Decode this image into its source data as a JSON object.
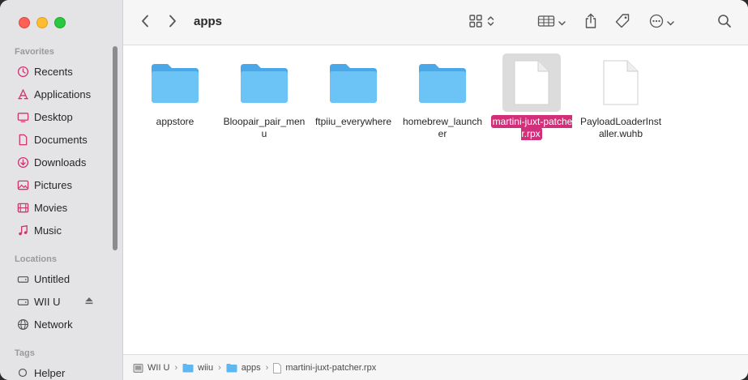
{
  "window": {
    "title": "apps"
  },
  "sidebar": {
    "favorites_header": "Favorites",
    "favorites": [
      {
        "label": "Recents",
        "icon": "clock-icon"
      },
      {
        "label": "Applications",
        "icon": "applications-icon"
      },
      {
        "label": "Desktop",
        "icon": "desktop-icon"
      },
      {
        "label": "Documents",
        "icon": "document-icon"
      },
      {
        "label": "Downloads",
        "icon": "download-icon"
      },
      {
        "label": "Pictures",
        "icon": "pictures-icon"
      },
      {
        "label": "Movies",
        "icon": "movies-icon"
      },
      {
        "label": "Music",
        "icon": "music-icon"
      }
    ],
    "locations_header": "Locations",
    "locations": [
      {
        "label": "Untitled",
        "icon": "drive-icon"
      },
      {
        "label": "WII U",
        "icon": "drive-icon"
      },
      {
        "label": "Network",
        "icon": "network-icon"
      }
    ],
    "tags_header": "Tags",
    "tags": [
      {
        "label": "Helper",
        "icon": "tag-circle-icon"
      }
    ]
  },
  "files": [
    {
      "name": "appstore",
      "type": "folder",
      "selected": false
    },
    {
      "name": "Bloopair_pair_menu",
      "type": "folder",
      "selected": false
    },
    {
      "name": "ftpiiu_everywhere",
      "type": "folder",
      "selected": false
    },
    {
      "name": "homebrew_launcher",
      "type": "folder",
      "selected": false
    },
    {
      "name": "martini-juxt-patcher.rpx",
      "type": "document",
      "selected": true
    },
    {
      "name": "PayloadLoaderInstaller.wuhb",
      "type": "document",
      "selected": false
    }
  ],
  "pathbar": {
    "crumbs": [
      {
        "label": "WII U",
        "icon": "drive-icon"
      },
      {
        "label": "wiiu",
        "icon": "folder-icon"
      },
      {
        "label": "apps",
        "icon": "folder-icon"
      },
      {
        "label": "martini-juxt-patcher.rpx",
        "icon": "document-icon"
      }
    ]
  },
  "colors": {
    "accent": "#d12f7a",
    "folder": "#5fb7f1",
    "sidebar_icon": "#d2336f"
  }
}
